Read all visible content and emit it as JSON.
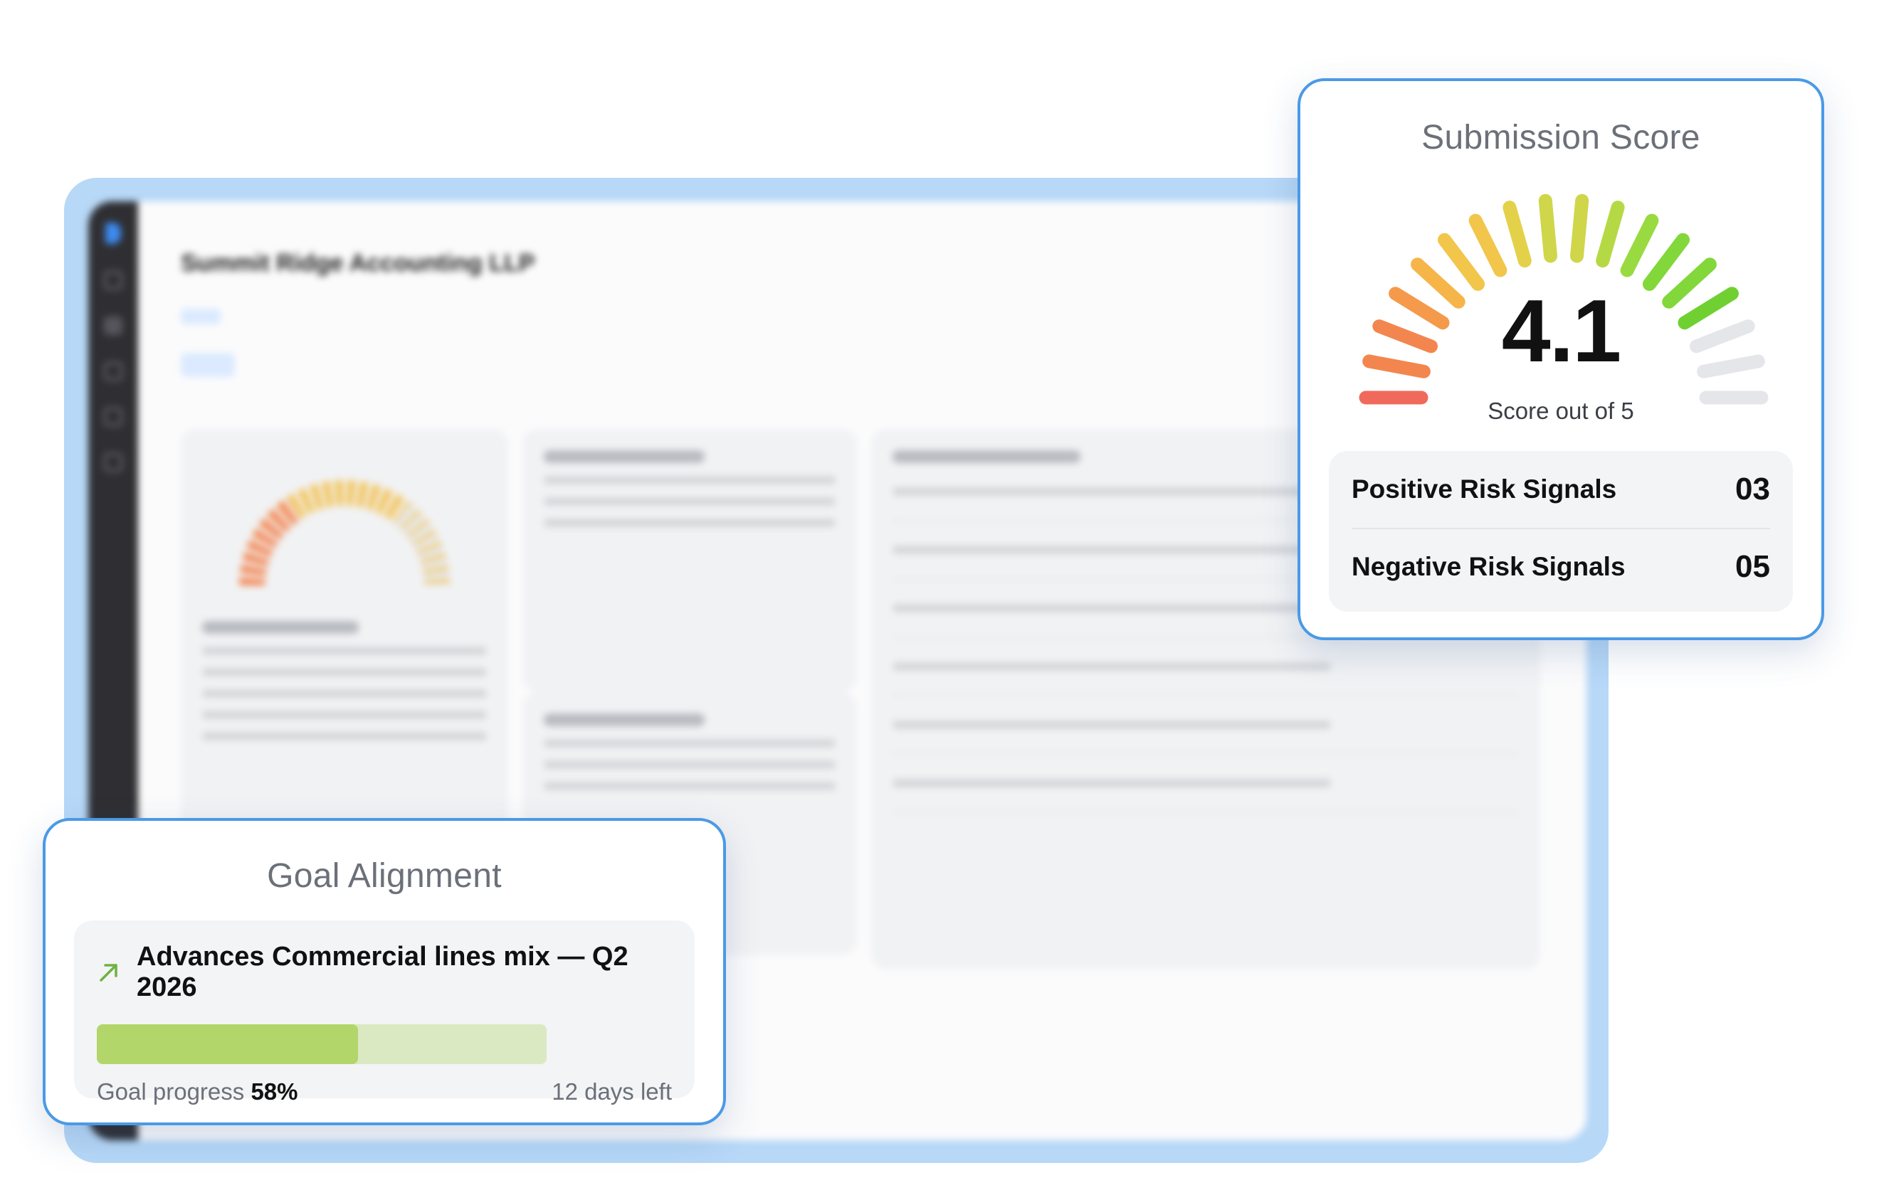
{
  "background_app": {
    "title": "Summit Ridge Accounting LLP"
  },
  "score_card": {
    "title": "Submission Score",
    "score": "4.1",
    "score_value": 4.1,
    "score_max": 5,
    "score_caption": "Score out of 5",
    "gauge_colors": [
      "#f06a5c",
      "#f3864f",
      "#f49a4a",
      "#f6b548",
      "#f1c64b",
      "#e4d14a",
      "#cfd64a",
      "#b5d945",
      "#99da40",
      "#82d73a",
      "#70d032",
      "#e4e6ea"
    ],
    "signals": [
      {
        "label": "Positive Risk Signals",
        "count": "03"
      },
      {
        "label": "Negative Risk Signals",
        "count": "05"
      }
    ]
  },
  "goal_card": {
    "title": "Goal Alignment",
    "goal_icon": "trend-up-arrow-icon",
    "goal_text": "Advances Commercial lines mix — Q2 2026",
    "progress_label": "Goal progress",
    "progress_value": "58%",
    "progress_fraction": 0.58,
    "days_left": "12 days left",
    "accent_color": "#b3d66a",
    "track_color": "#dbe9c2"
  }
}
